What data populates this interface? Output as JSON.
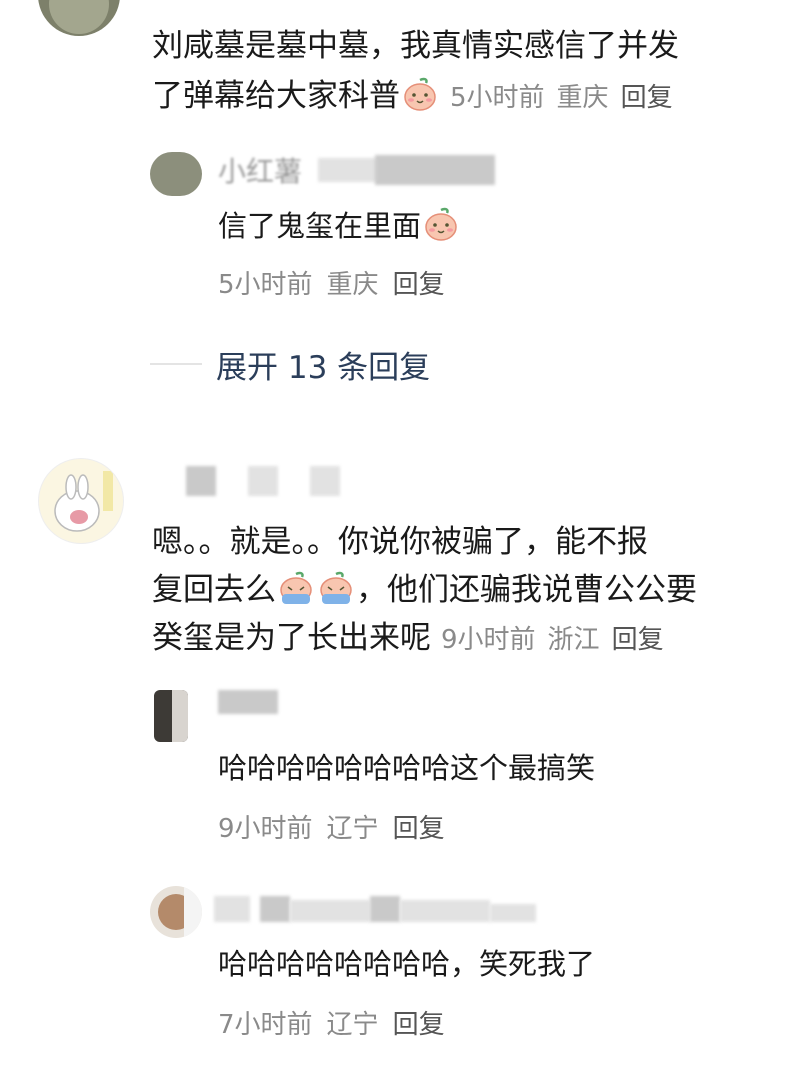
{
  "comment1": {
    "line1": "刘咸墓是墓中墓，我真情实感信了并发",
    "line2": "了弹幕给大家科普",
    "emoji": "peach-face-emoji",
    "time": "5小时前",
    "location": "重庆",
    "reply_label": "回复",
    "replies": [
      {
        "username_partial": "小红薯",
        "text": "信了鬼玺在里面",
        "emoji": "peach-face-emoji",
        "time": "5小时前",
        "location": "重庆",
        "reply_label": "回复"
      }
    ],
    "expand_label": "展开 13 条回复"
  },
  "comment2": {
    "line1": "嗯。。就是。。你说你被骗了，能不报",
    "line2a": "复回去么",
    "line2b": "，他们还骗我说曹公公要",
    "line3": "癸玺是为了长出来呢",
    "emoji": "crying-peach-emoji",
    "time": "9小时前",
    "location": "浙江",
    "reply_label": "回复",
    "replies": [
      {
        "text": "哈哈哈哈哈哈哈哈这个最搞笑",
        "time": "9小时前",
        "location": "辽宁",
        "reply_label": "回复"
      },
      {
        "text": "哈哈哈哈哈哈哈哈，笑死我了",
        "time": "7小时前",
        "location": "辽宁",
        "reply_label": "回复"
      }
    ]
  }
}
